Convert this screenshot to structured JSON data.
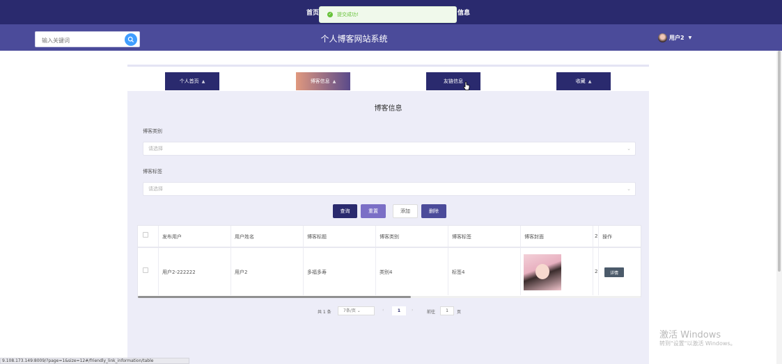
{
  "topnav": {
    "items": [
      "首页",
      "信息"
    ]
  },
  "toast": {
    "message": "提交成功!",
    "icon": "check-circle-icon"
  },
  "header": {
    "search_placeholder": "输入关键词",
    "title": "个人博客网站系统",
    "username": "用户2"
  },
  "tabs": [
    {
      "label": "个人首页"
    },
    {
      "label": "博客信息"
    },
    {
      "label": "友链信息"
    },
    {
      "label": "收藏"
    }
  ],
  "main": {
    "heading": "博客信息",
    "filters": [
      {
        "label": "博客类别",
        "placeholder": "请选择"
      },
      {
        "label": "博客标签",
        "placeholder": "请选择"
      }
    ],
    "buttons": {
      "query": "查询",
      "reset": "重置",
      "add": "添加",
      "delete": "删除"
    }
  },
  "table": {
    "headers": [
      "发布用户",
      "用户姓名",
      "博客标题",
      "博客类别",
      "博客标签",
      "博客封面",
      "操作"
    ],
    "rows": [
      {
        "publisher": "用户2-222222",
        "name": "用户2",
        "title": "多福多寿",
        "category": "类别4",
        "tag": "标签4",
        "cut": "2",
        "action": "详情"
      }
    ],
    "cut_header": "2"
  },
  "pager": {
    "total": "共 1 条",
    "page_size": "7条/页",
    "current": "1",
    "goto_label": "前往",
    "goto_value": "1",
    "page_suffix": "页"
  },
  "watermark": {
    "line1": "激活 Windows",
    "line2": "转到\"设置\"以激活 Windows。"
  },
  "statusbar": {
    "url": "9.108.173.149:8009/?page=1&size=12#/friendly_link_information/table"
  },
  "colors": {
    "nav": "#2a2a6e",
    "header": "#4b4b9a",
    "content": "#ededf8",
    "success": "#67c23a"
  }
}
